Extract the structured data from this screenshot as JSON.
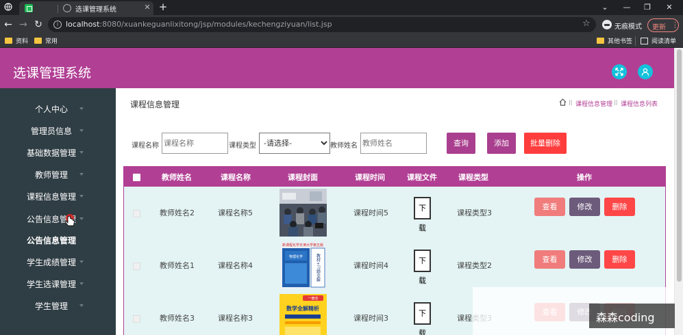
{
  "browser": {
    "tab_title": "选课管理系统",
    "url_host": "localhost",
    "url_path": ":8080/xuankeguanlixitong/jsp/modules/kechengziyuan/list.jsp",
    "incognito_label": "无痕模式",
    "update_label": "更新",
    "bookmarks": [
      "资料",
      "常用"
    ],
    "bookmarks_right": [
      "其他书签",
      "阅读清单"
    ]
  },
  "app": {
    "title": "选课管理系统"
  },
  "sidebar": {
    "items": [
      {
        "label": "个人中心"
      },
      {
        "label": "管理员信息"
      },
      {
        "label": "基础数据管理"
      },
      {
        "label": "教师管理"
      },
      {
        "label": "课程信息管理"
      },
      {
        "label": "公告信息管理"
      },
      {
        "label": "公告信息管理"
      },
      {
        "label": "学生成绩管理"
      },
      {
        "label": "学生选课管理"
      },
      {
        "label": "学生管理"
      }
    ]
  },
  "page": {
    "heading": "课程信息管理",
    "breadcrumb": [
      "课程信息管理",
      "课程信息列表"
    ]
  },
  "filters": {
    "course_name_label": "课程名称",
    "course_name_placeholder": "课程名称",
    "course_type_label": "课程类型",
    "course_type_value": "-请选择-",
    "teacher_name_label": "教师姓名",
    "teacher_name_placeholder": "教师姓名",
    "search_label": "查询",
    "add_label": "添加",
    "batch_delete_label": "批量删除"
  },
  "table": {
    "headers": [
      "教师姓名",
      "课程名称",
      "课程封面",
      "课程时间",
      "课程文件",
      "课程类型",
      "操作"
    ],
    "rows": [
      {
        "teacher": "教师姓名2",
        "course": "课程名称5",
        "time": "课程时间5",
        "file": "下载",
        "type": "课程类型3",
        "cover": "photo"
      },
      {
        "teacher": "教师姓名1",
        "course": "课程名称4",
        "time": "课程时间4",
        "file": "下载",
        "type": "课程类型2",
        "cover": "book-blue"
      },
      {
        "teacher": "教师姓名3",
        "course": "课程名称3",
        "time": "课程时间3",
        "file": "下载",
        "type": "课程类型3",
        "cover": "book-yellow"
      }
    ],
    "actions": {
      "view": "查看",
      "edit": "修改",
      "delete": "删除"
    }
  },
  "cover_text": {
    "blue_top": "新课程化学天津大学第五版",
    "blue_book": "物理化学",
    "blue_side": "教材+习题全解",
    "yellow_badge": "一册全",
    "yellow_title": "数学全解精析"
  },
  "watermark": "森森coding",
  "colors": {
    "brand": "#b13f94",
    "sidebar": "#2f3d44",
    "accent_cyan": "#14c2dc",
    "danger": "#ff4747",
    "row_bg": "#e4f4f4"
  }
}
